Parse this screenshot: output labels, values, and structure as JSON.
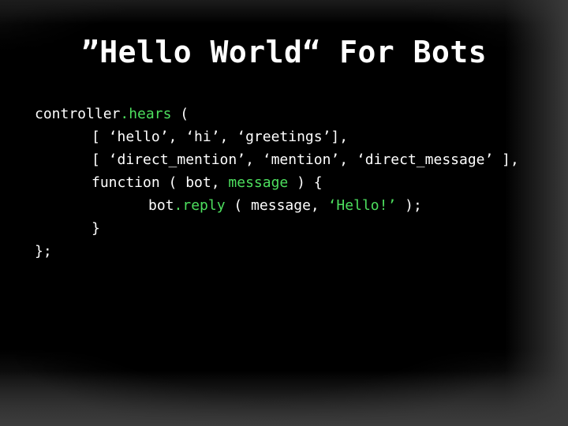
{
  "slide": {
    "title": "”Hello World“ For Bots"
  },
  "code": {
    "l1_a": "controller",
    "l1_dot": ".",
    "l1_kw": "hears",
    "l1_b": " (",
    "l2": "[ ‘hello’, ‘hi’, ‘greetings’],",
    "l3": "[ ‘direct_mention’, ‘mention’, ‘direct_message’ ],",
    "l4_a": "function ( bot, ",
    "l4_kw": "message",
    "l4_b": " ) {",
    "l5_a": "bot",
    "l5_dot": ".",
    "l5_kw": "reply",
    "l5_b": " ( message, ",
    "l5_str": "‘Hello!’",
    "l5_c": " );",
    "l6": "}",
    "l7": "};"
  },
  "colors": {
    "background": "#000000",
    "text": "#ffffff",
    "highlight": "#4ddf5e"
  }
}
